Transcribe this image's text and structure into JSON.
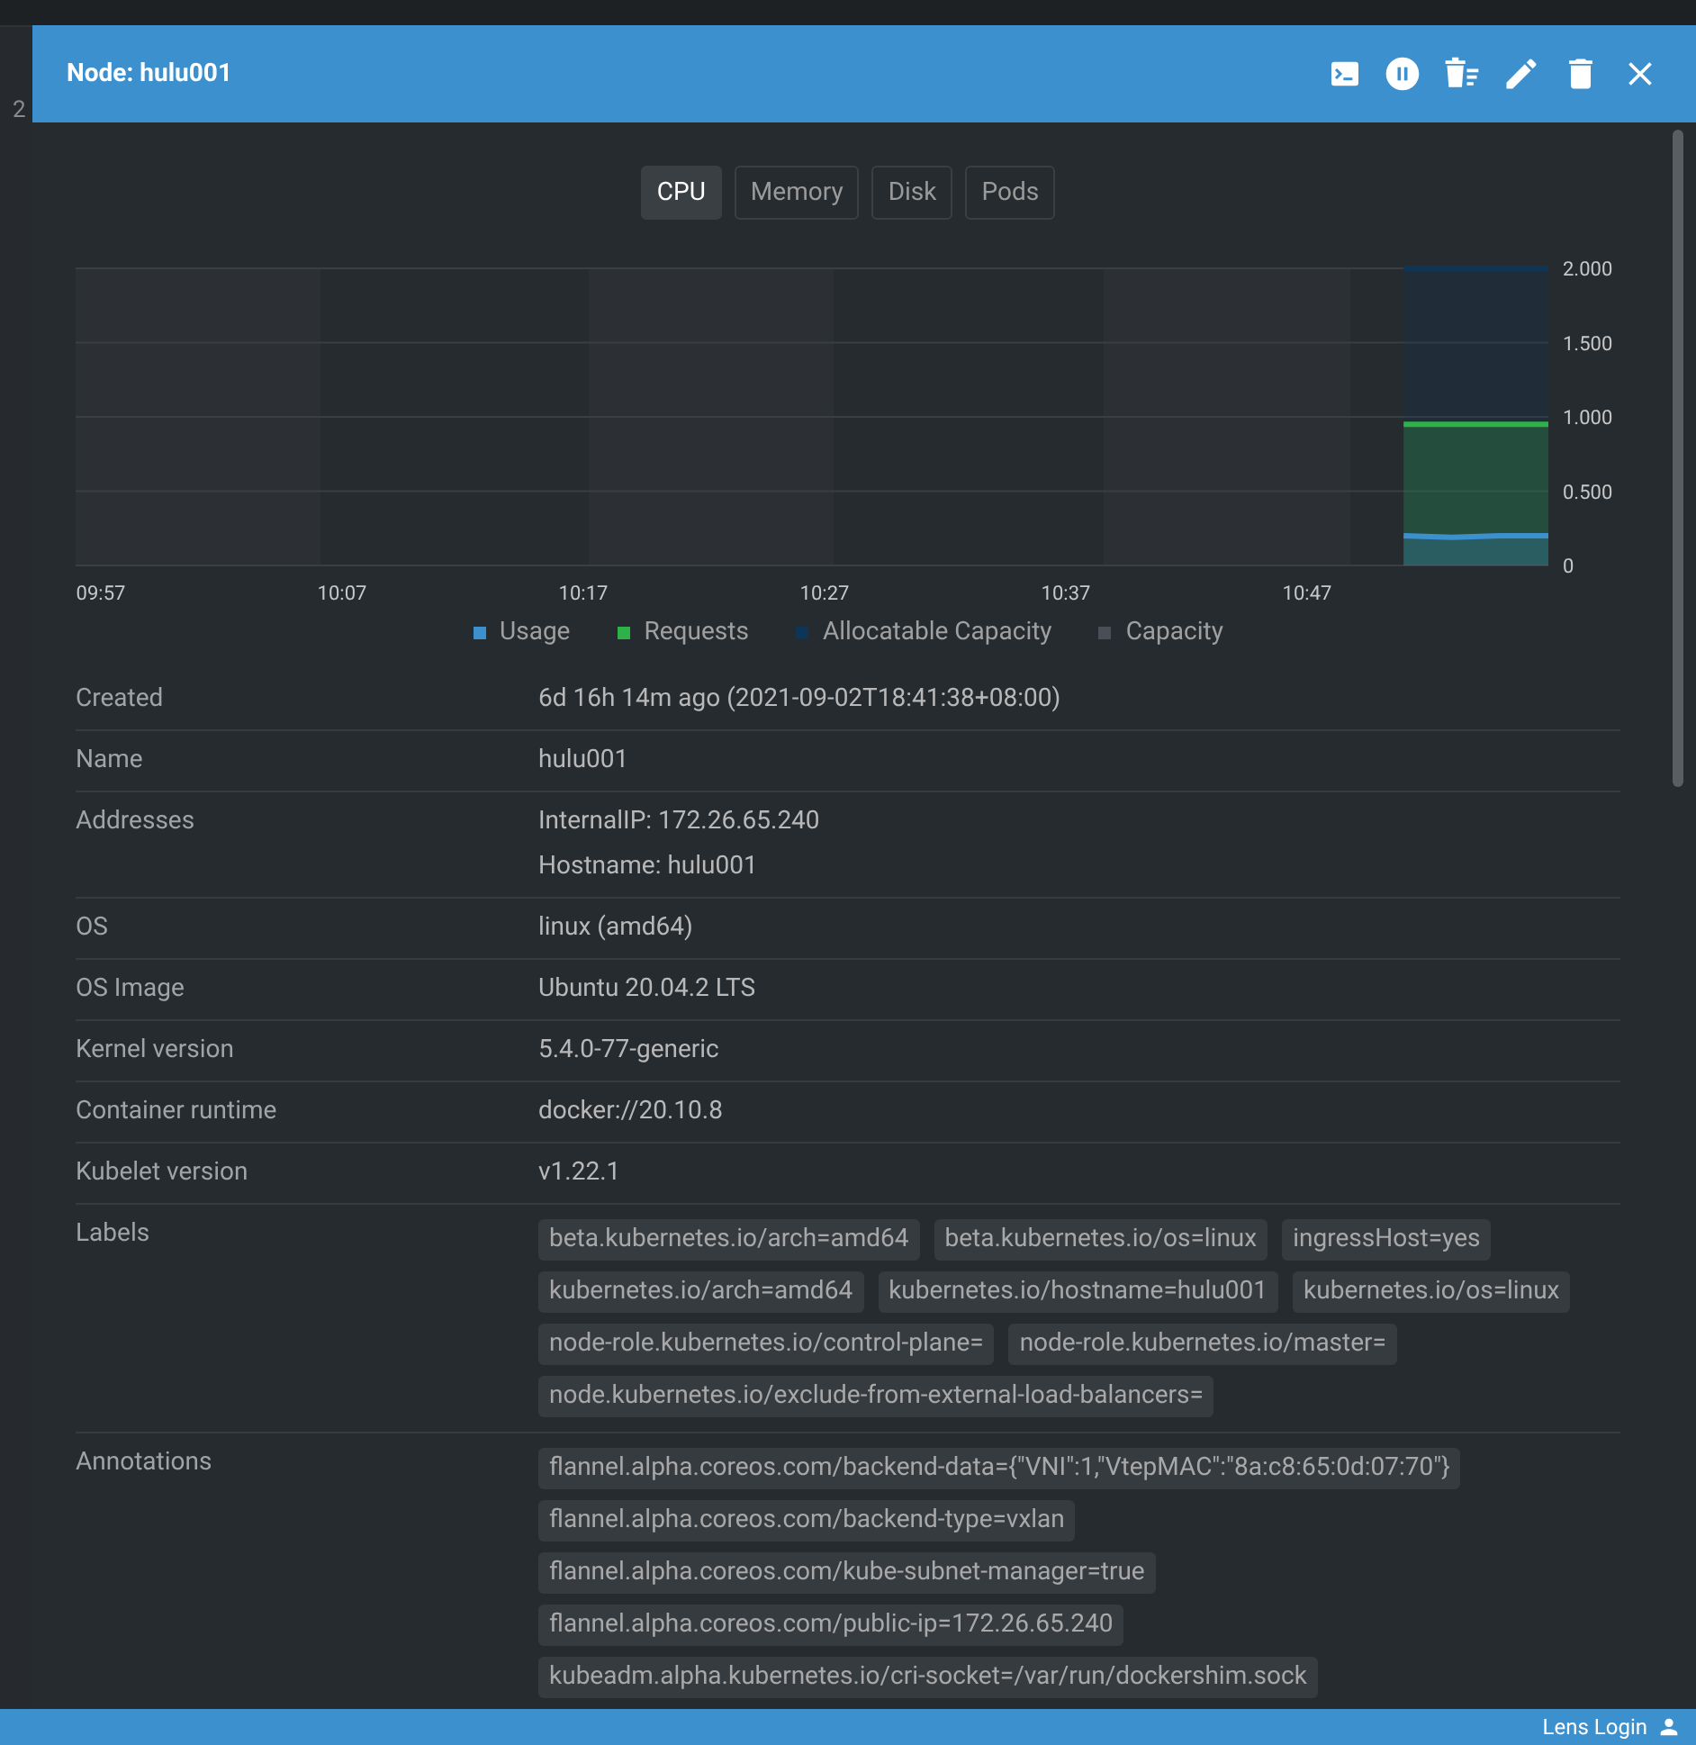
{
  "background": {
    "text": "2"
  },
  "drawer": {
    "title": "Node: hulu001",
    "metric_tabs": [
      {
        "label": "CPU",
        "selected": true
      },
      {
        "label": "Memory",
        "selected": false
      },
      {
        "label": "Disk",
        "selected": false
      },
      {
        "label": "Pods",
        "selected": false
      }
    ],
    "chart_data": {
      "type": "area",
      "ylim": [
        0,
        2
      ],
      "grid": true,
      "categories": [
        "09:57",
        null,
        null,
        null,
        null,
        "10:07",
        null,
        null,
        null,
        null,
        "10:17",
        null,
        null,
        null,
        null,
        "10:27",
        null,
        null,
        null,
        null,
        "10:37",
        null,
        null,
        null,
        null,
        "10:47",
        null,
        null,
        null,
        null,
        null
      ],
      "yticks": [
        {
          "value": 0,
          "label": "0"
        },
        {
          "value": 0.5,
          "label": "0.500"
        },
        {
          "value": 1,
          "label": "1.000"
        },
        {
          "value": 1.5,
          "label": "1.500"
        },
        {
          "value": 2,
          "label": "2.000"
        }
      ],
      "series": [
        {
          "name": "Usage",
          "color": "#3d90ce",
          "values": [
            null,
            null,
            null,
            null,
            null,
            null,
            null,
            null,
            null,
            null,
            null,
            null,
            null,
            null,
            null,
            null,
            null,
            null,
            null,
            null,
            null,
            null,
            null,
            null,
            null,
            null,
            null,
            0.2,
            0.19,
            0.2,
            0.2
          ]
        },
        {
          "name": "Requests",
          "color": "#2fb14a",
          "values": [
            null,
            null,
            null,
            null,
            null,
            null,
            null,
            null,
            null,
            null,
            null,
            null,
            null,
            null,
            null,
            null,
            null,
            null,
            null,
            null,
            null,
            null,
            null,
            null,
            null,
            null,
            null,
            0.95,
            0.95,
            0.95,
            0.95
          ]
        },
        {
          "name": "Allocatable Capacity",
          "color": "#0e3556",
          "values": [
            null,
            null,
            null,
            null,
            null,
            null,
            null,
            null,
            null,
            null,
            null,
            null,
            null,
            null,
            null,
            null,
            null,
            null,
            null,
            null,
            null,
            null,
            null,
            null,
            null,
            null,
            null,
            2,
            2,
            2,
            2
          ]
        },
        {
          "name": "Capacity",
          "color": "#4a4f57",
          "values": [
            null,
            null,
            null,
            null,
            null,
            null,
            null,
            null,
            null,
            null,
            null,
            null,
            null,
            null,
            null,
            null,
            null,
            null,
            null,
            null,
            null,
            null,
            null,
            null,
            null,
            null,
            null,
            null,
            null,
            null,
            null
          ]
        }
      ]
    },
    "details": [
      {
        "label": "Created",
        "kind": "text",
        "value": "6d 16h 14m ago (2021-09-02T18:41:38+08:00)"
      },
      {
        "label": "Name",
        "kind": "text",
        "value": "hulu001"
      },
      {
        "label": "Addresses",
        "kind": "lines",
        "values": [
          "InternalIP: 172.26.65.240",
          "Hostname: hulu001"
        ]
      },
      {
        "label": "OS",
        "kind": "text",
        "value": "linux (amd64)"
      },
      {
        "label": "OS Image",
        "kind": "text",
        "value": "Ubuntu 20.04.2 LTS"
      },
      {
        "label": "Kernel version",
        "kind": "text",
        "value": "5.4.0-77-generic"
      },
      {
        "label": "Container runtime",
        "kind": "text",
        "value": "docker://20.10.8"
      },
      {
        "label": "Kubelet version",
        "kind": "text",
        "value": "v1.22.1"
      },
      {
        "label": "Labels",
        "kind": "chips",
        "values": [
          "beta.kubernetes.io/arch=amd64",
          "beta.kubernetes.io/os=linux",
          "ingressHost=yes",
          "kubernetes.io/arch=amd64",
          "kubernetes.io/hostname=hulu001",
          "kubernetes.io/os=linux",
          "node-role.kubernetes.io/control-plane=",
          "node-role.kubernetes.io/master=",
          "node.kubernetes.io/exclude-from-external-load-balancers="
        ]
      },
      {
        "label": "Annotations",
        "kind": "chip_list",
        "values": [
          "flannel.alpha.coreos.com/backend-data={\"VNI\":1,\"VtepMAC\":\"8a:c8:65:0d:07:70\"}",
          "flannel.alpha.coreos.com/backend-type=vxlan",
          "flannel.alpha.coreos.com/kube-subnet-manager=true",
          "flannel.alpha.coreos.com/public-ip=172.26.65.240",
          "kubeadm.alpha.kubernetes.io/cri-socket=/var/run/dockershim.sock"
        ]
      }
    ]
  },
  "status_bar": {
    "login": "Lens Login"
  }
}
